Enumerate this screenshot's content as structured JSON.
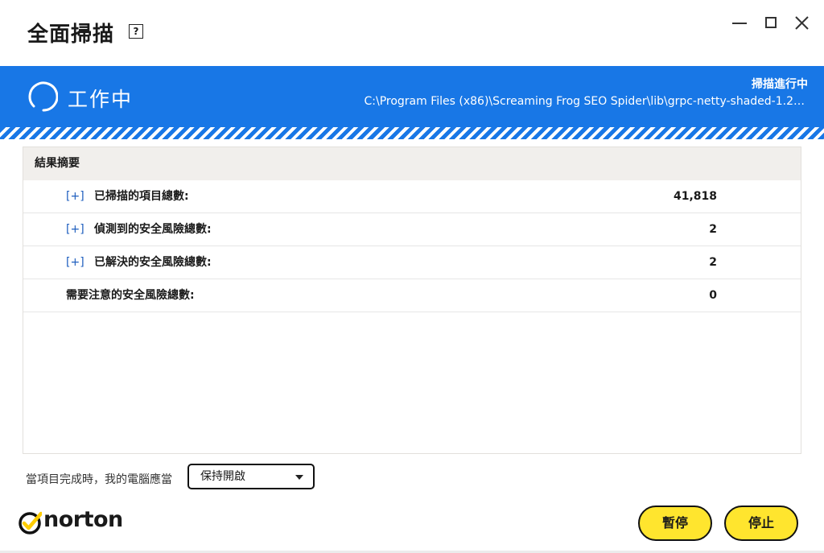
{
  "window": {
    "title": "全面掃描",
    "help_label": "?"
  },
  "status": {
    "state": "工作中",
    "scan_label": "掃描進行中",
    "current_path": "C:\\Program Files (x86)\\Screaming Frog SEO Spider\\lib\\grpc-netty-shaded-1.2…"
  },
  "summary": {
    "header": "結果摘要",
    "expand_label": "[+]",
    "rows": [
      {
        "label": "已掃描的項目總數:",
        "value": "41,818"
      },
      {
        "label": "偵測到的安全風險總數:",
        "value": "2"
      },
      {
        "label": "已解決的安全風險總數:",
        "value": "2"
      },
      {
        "label": "需要注意的安全風險總數:",
        "value": "0"
      }
    ]
  },
  "completion": {
    "prompt": "當項目完成時，我的電腦應當",
    "selected_option": "保持開啟"
  },
  "brand": {
    "name": "norton",
    "accent_color": "#ffe52e",
    "banner_color": "#1877e6"
  },
  "actions": {
    "pause_label": "暫停",
    "stop_label": "停止"
  }
}
